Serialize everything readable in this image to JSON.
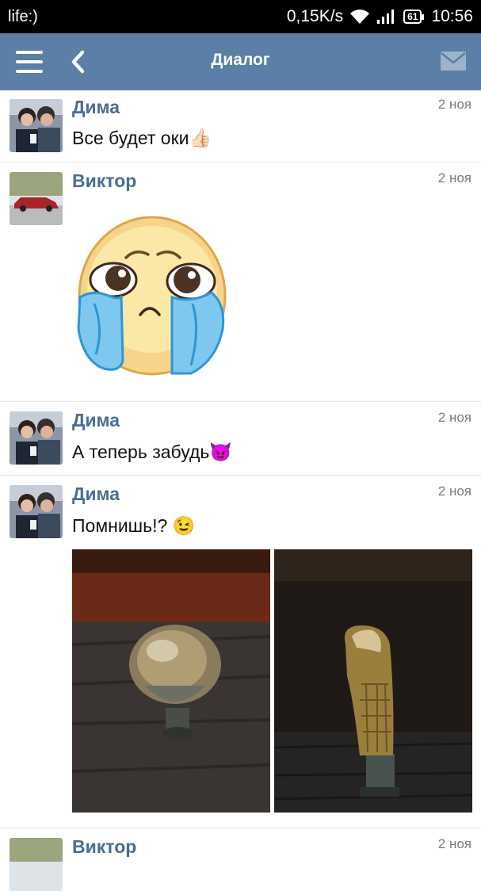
{
  "status_bar": {
    "carrier": "life:)",
    "speed": "0,15K/s",
    "battery": "61",
    "time": "10:56"
  },
  "app_bar": {
    "title": "Диалог"
  },
  "messages": [
    {
      "author": "Дима",
      "date": "2 ноя",
      "text": "Все будет оки",
      "emoji": "👍🏻"
    },
    {
      "author": "Виктор",
      "date": "2 ноя",
      "sticker": "crying-face-sticker"
    },
    {
      "author": "Дима",
      "date": "2 ноя",
      "text": "А теперь забудь",
      "emoji": "😈"
    },
    {
      "author": "Дима",
      "date": "2 ноя",
      "text": "Помнишь!? ",
      "emoji": "😉"
    },
    {
      "author": "Виктор",
      "date": "2 ноя"
    }
  ]
}
